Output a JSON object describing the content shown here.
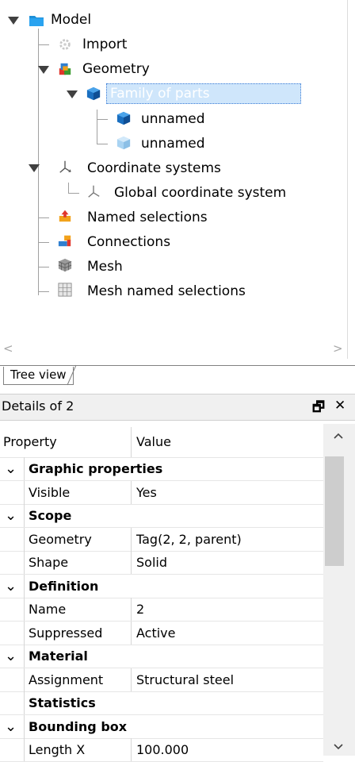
{
  "tree": {
    "model": "Model",
    "import": "Import",
    "geometry": "Geometry",
    "family": "Family of parts",
    "part1": "unnamed",
    "part2": "unnamed",
    "coord": "Coordinate systems",
    "global": "Global coordinate system",
    "named": "Named selections",
    "connections": "Connections",
    "mesh": "Mesh",
    "meshnamed": "Mesh named selections"
  },
  "scroll": {
    "left": "<",
    "right": ">"
  },
  "tabs": {
    "tree_view": "Tree view"
  },
  "details": {
    "title": "Details of 2",
    "pin": "🗗",
    "close": "✕",
    "header_property": "Property",
    "header_value": "Value",
    "rows": [
      {
        "type": "group",
        "label": "Graphic properties",
        "expander": "⌄"
      },
      {
        "type": "prop",
        "label": "Visible",
        "value": "Yes"
      },
      {
        "type": "group",
        "label": "Scope",
        "expander": "⌄"
      },
      {
        "type": "prop",
        "label": "Geometry",
        "value": "Tag(2, 2, parent)"
      },
      {
        "type": "prop",
        "label": "Shape",
        "value": "Solid"
      },
      {
        "type": "group",
        "label": "Definition",
        "expander": "⌄"
      },
      {
        "type": "prop",
        "label": "Name",
        "value": "2"
      },
      {
        "type": "prop",
        "label": "Suppressed",
        "value": "Active"
      },
      {
        "type": "group",
        "label": "Material",
        "expander": "⌄"
      },
      {
        "type": "prop",
        "label": "Assignment",
        "value": "Structural steel"
      },
      {
        "type": "group",
        "label": "Statistics",
        "expander": ""
      },
      {
        "type": "group",
        "label": "Bounding box",
        "expander": "⌄"
      },
      {
        "type": "prop",
        "label": "Length X",
        "value": "100.000"
      }
    ]
  }
}
